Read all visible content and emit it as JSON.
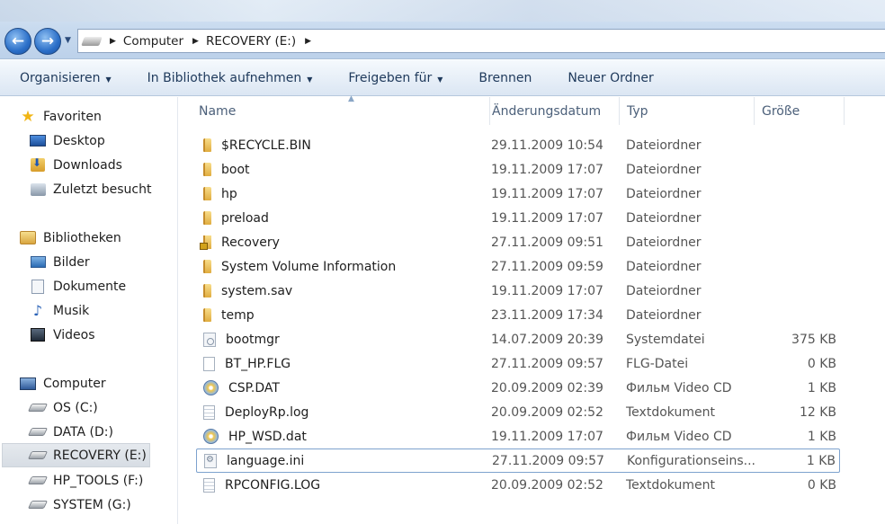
{
  "window": {
    "breadcrumb": [
      "Computer",
      "RECOVERY (E:)"
    ],
    "back_icon": "back-arrow-icon",
    "forward_icon": "forward-arrow-icon"
  },
  "toolbar": {
    "organize": "Organisieren",
    "include_library": "In Bibliothek aufnehmen",
    "share": "Freigeben für",
    "burn": "Brennen",
    "new_folder": "Neuer Ordner"
  },
  "nav": {
    "favorites": "Favoriten",
    "favorites_items": [
      "Desktop",
      "Downloads",
      "Zuletzt besucht"
    ],
    "libraries": "Bibliotheken",
    "libraries_items": [
      "Bilder",
      "Dokumente",
      "Musik",
      "Videos"
    ],
    "computer": "Computer",
    "drives": [
      "OS (C:)",
      "DATA (D:)",
      "RECOVERY (E:)",
      "HP_TOOLS (F:)",
      "SYSTEM (G:)"
    ],
    "selected_drive": "RECOVERY (E:)"
  },
  "columns": {
    "name": "Name",
    "date": "Änderungsdatum",
    "type": "Typ",
    "size": "Größe"
  },
  "files": [
    {
      "name": "$RECYCLE.BIN",
      "date": "29.11.2009 10:54",
      "type": "Dateiordner",
      "size": "",
      "icon": "folder-icon"
    },
    {
      "name": "boot",
      "date": "19.11.2009 17:07",
      "type": "Dateiordner",
      "size": "",
      "icon": "folder-icon"
    },
    {
      "name": "hp",
      "date": "19.11.2009 17:07",
      "type": "Dateiordner",
      "size": "",
      "icon": "folder-icon"
    },
    {
      "name": "preload",
      "date": "19.11.2009 17:07",
      "type": "Dateiordner",
      "size": "",
      "icon": "folder-icon"
    },
    {
      "name": "Recovery",
      "date": "27.11.2009 09:51",
      "type": "Dateiordner",
      "size": "",
      "icon": "locked-folder-icon"
    },
    {
      "name": "System Volume Information",
      "date": "27.11.2009 09:59",
      "type": "Dateiordner",
      "size": "",
      "icon": "folder-icon"
    },
    {
      "name": "system.sav",
      "date": "19.11.2009 17:07",
      "type": "Dateiordner",
      "size": "",
      "icon": "folder-icon"
    },
    {
      "name": "temp",
      "date": "23.11.2009 17:34",
      "type": "Dateiordner",
      "size": "",
      "icon": "folder-icon"
    },
    {
      "name": "bootmgr",
      "date": "14.07.2009 20:39",
      "type": "Systemdatei",
      "size": "375 KB",
      "icon": "system-file-icon"
    },
    {
      "name": "BT_HP.FLG",
      "date": "27.11.2009 09:57",
      "type": "FLG-Datei",
      "size": "0 KB",
      "icon": "blank-file-icon"
    },
    {
      "name": "CSP.DAT",
      "date": "20.09.2009 02:39",
      "type": "Фильм Video CD",
      "size": "1 KB",
      "icon": "video-cd-icon"
    },
    {
      "name": "DeployRp.log",
      "date": "20.09.2009 02:52",
      "type": "Textdokument",
      "size": "12 KB",
      "icon": "text-file-icon"
    },
    {
      "name": "HP_WSD.dat",
      "date": "19.11.2009 17:07",
      "type": "Фильм Video CD",
      "size": "1 KB",
      "icon": "video-cd-icon"
    },
    {
      "name": "language.ini",
      "date": "27.11.2009 09:57",
      "type": "Konfigurationseins...",
      "size": "1 KB",
      "icon": "config-file-icon"
    },
    {
      "name": "RPCONFIG.LOG",
      "date": "20.09.2009 02:52",
      "type": "Textdokument",
      "size": "0 KB",
      "icon": "text-file-icon"
    }
  ],
  "focused_file": "language.ini"
}
